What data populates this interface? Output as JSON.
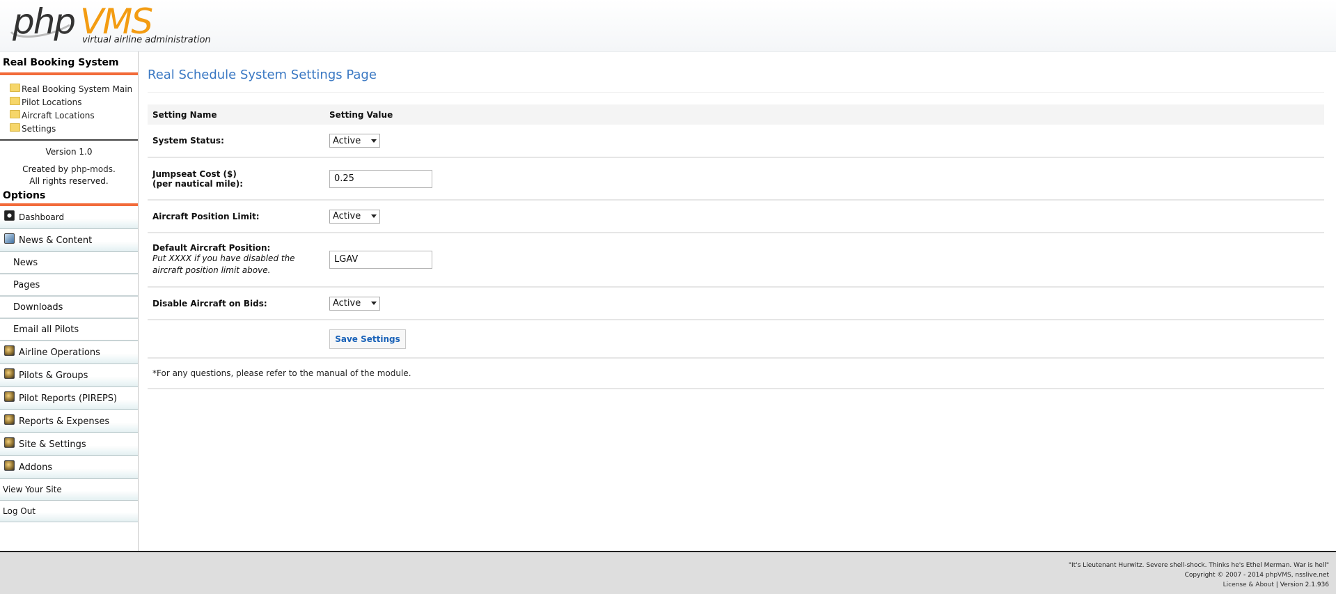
{
  "header": {
    "logo_php": "php",
    "logo_vms": "VMS",
    "tagline": "virtual airline administration"
  },
  "sidebar": {
    "section_title": "Real Booking System",
    "booking_links": [
      {
        "label": "Real Booking System Main",
        "icon": "folder-icon"
      },
      {
        "label": "Pilot Locations",
        "icon": "folder-icon"
      },
      {
        "label": "Aircraft Locations",
        "icon": "folder-icon"
      },
      {
        "label": "Settings",
        "icon": "folder-icon"
      }
    ],
    "version": "Version 1.0",
    "created_prefix": "Created by",
    "created_link": "php-mods",
    "created_suffix": ".",
    "rights": "All rights reserved.",
    "options_title": "Options",
    "menu": {
      "dashboard": "Dashboard",
      "news_content": "News & Content",
      "news": "News",
      "pages": "Pages",
      "downloads": "Downloads",
      "email_all": "Email all Pilots",
      "airline_ops": "Airline Operations",
      "pilots_groups": "Pilots & Groups",
      "pilot_reports": "Pilot Reports (PIREPS)",
      "reports_expenses": "Reports & Expenses",
      "site_settings": "Site & Settings",
      "addons": "Addons",
      "view_site": "View Your Site",
      "logout": "Log Out"
    }
  },
  "main": {
    "title": "Real Schedule System Settings Page",
    "col_name": "Setting Name",
    "col_value": "Setting Value",
    "rows": {
      "system_status": {
        "label": "System Status:",
        "value": "Active"
      },
      "jumpseat": {
        "label": "Jumpseat Cost ($)",
        "label2": "(per nautical mile):",
        "value": "0.25"
      },
      "position_limit": {
        "label": "Aircraft Position Limit:",
        "value": "Active"
      },
      "default_position": {
        "label": "Default Aircraft Position:",
        "note": "Put XXXX if you have disabled the aircraft position limit above.",
        "value": "LGAV"
      },
      "disable_bids": {
        "label": "Disable Aircraft on Bids:",
        "value": "Active"
      }
    },
    "save_label": "Save Settings",
    "footnote": "*For any questions, please refer to the manual of the module."
  },
  "footer": {
    "quote": "\"It's Lieutenant Hurwitz. Severe shell-shock. Thinks he's Ethel Merman. War is hell\"",
    "copyright_prefix": "Copyright © 2007 - 2014",
    "copyright_link": "phpVMS",
    "copyright_suffix": ", nsslive.net",
    "license": "License & About",
    "version": "| Version 2.1.936"
  },
  "colors": {
    "accent_orange": "#f26b3a",
    "title_blue": "#3a78c3",
    "logo_orange": "#f39c12"
  }
}
